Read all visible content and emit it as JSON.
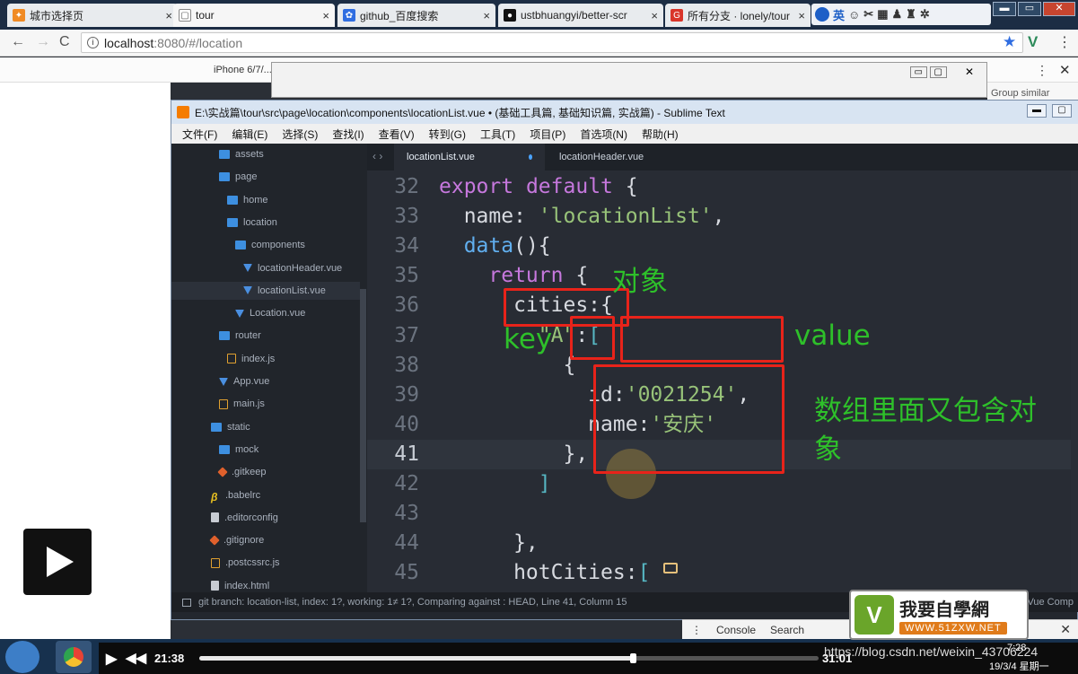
{
  "browser": {
    "tabs": [
      {
        "label": "城市选择页",
        "fav_color": "#f08a24",
        "fav_glyph": "✦"
      },
      {
        "label": "tour",
        "fav_color": "#ffffff",
        "fav_glyph": "▢"
      },
      {
        "label": "github_百度搜索",
        "fav_color": "#2f6de1",
        "fav_glyph": "✿"
      },
      {
        "label": "ustbhuangyi/better-scr",
        "fav_color": "#111111",
        "fav_glyph": "●"
      },
      {
        "label": "所有分支 · lonely/tour ·",
        "fav_color": "#d9352a",
        "fav_glyph": "G"
      }
    ],
    "tab_close": "×",
    "ext_label": "英",
    "url_host": "localhost",
    "url_rest": ":8080/#/location",
    "device_label": "iPhone 6/7/...",
    "group_similar": "Group similar"
  },
  "sublime": {
    "title": "E:\\实战篇\\tour\\src\\page\\location\\components\\locationList.vue • (基础工具篇, 基础知识篇, 实战篇) - Sublime Text",
    "menu": [
      "文件(F)",
      "编辑(E)",
      "选择(S)",
      "查找(I)",
      "查看(V)",
      "转到(G)",
      "工具(T)",
      "项目(P)",
      "首选项(N)",
      "帮助(H)"
    ],
    "sidebar": [
      {
        "label": "assets",
        "icon": "folder-icon",
        "indent": 1
      },
      {
        "label": "page",
        "icon": "folder-icon",
        "indent": 1
      },
      {
        "label": "home",
        "icon": "folder-icon",
        "indent": 2
      },
      {
        "label": "location",
        "icon": "folder-icon",
        "indent": 2
      },
      {
        "label": "components",
        "icon": "folder-icon",
        "indent": 3
      },
      {
        "label": "locationHeader.vue",
        "icon": "vue-icon",
        "indent": 4
      },
      {
        "label": "locationList.vue",
        "icon": "vue-icon",
        "indent": 4,
        "selected": true
      },
      {
        "label": "Location.vue",
        "icon": "vue-icon",
        "indent": 3
      },
      {
        "label": "router",
        "icon": "folder-icon",
        "indent": 1
      },
      {
        "label": "index.js",
        "icon": "js-icon",
        "indent": 2
      },
      {
        "label": "App.vue",
        "icon": "vue-icon",
        "indent": 1
      },
      {
        "label": "main.js",
        "icon": "js-icon",
        "indent": 1
      },
      {
        "label": "static",
        "icon": "folder-icon",
        "indent": 0
      },
      {
        "label": "mock",
        "icon": "folder-icon",
        "indent": 1
      },
      {
        "label": ".gitkeep",
        "icon": "git-icon",
        "indent": 1
      },
      {
        "label": ".babelrc",
        "icon": "babel-icon",
        "indent": 0
      },
      {
        "label": ".editorconfig",
        "icon": "file-icon",
        "indent": 0
      },
      {
        "label": ".gitignore",
        "icon": "git-icon",
        "indent": 0
      },
      {
        "label": ".postcssrc.js",
        "icon": "js-icon",
        "indent": 0
      },
      {
        "label": "index.html",
        "icon": "file-icon",
        "indent": 0
      }
    ],
    "editor_tabs": [
      "locationList.vue",
      "locationHeader.vue"
    ],
    "lines": [
      {
        "n": "32",
        "code": "export default {"
      },
      {
        "n": "33",
        "code": "  name: 'locationList',"
      },
      {
        "n": "34",
        "code": "  data(){"
      },
      {
        "n": "35",
        "code": "    return {"
      },
      {
        "n": "36",
        "code": "      cities:{"
      },
      {
        "n": "37",
        "code": "        \"A\":["
      },
      {
        "n": "38",
        "code": "          {"
      },
      {
        "n": "39",
        "code": "            id:'0021254',"
      },
      {
        "n": "40",
        "code": "            name:'安庆'"
      },
      {
        "n": "41",
        "code": "          },",
        "current": true
      },
      {
        "n": "42",
        "code": "        ]"
      },
      {
        "n": "43",
        "code": ""
      },
      {
        "n": "44",
        "code": "      },"
      },
      {
        "n": "45",
        "code": "      hotCities:["
      }
    ],
    "status": "git branch: location-list, index: 1?, working: 1≠ 1?, Comparing against : HEAD, Line 41, Column 15",
    "status_right": "Vue Comp"
  },
  "annotations": {
    "object": "对象",
    "key": "key",
    "value": "value",
    "array_note": "数组里面又包含对象"
  },
  "devtools": {
    "console": "Console",
    "search": "Search"
  },
  "player": {
    "elapsed": "21:38",
    "total": "31:01",
    "progress": 0.7,
    "watermark": "https://blog.csdn.net/weixin_43706224",
    "clock": "7:28",
    "date": "19/3/4 星期一",
    "logo_title": "我要自學網",
    "logo_url": "WWW.51ZXW.NET"
  }
}
